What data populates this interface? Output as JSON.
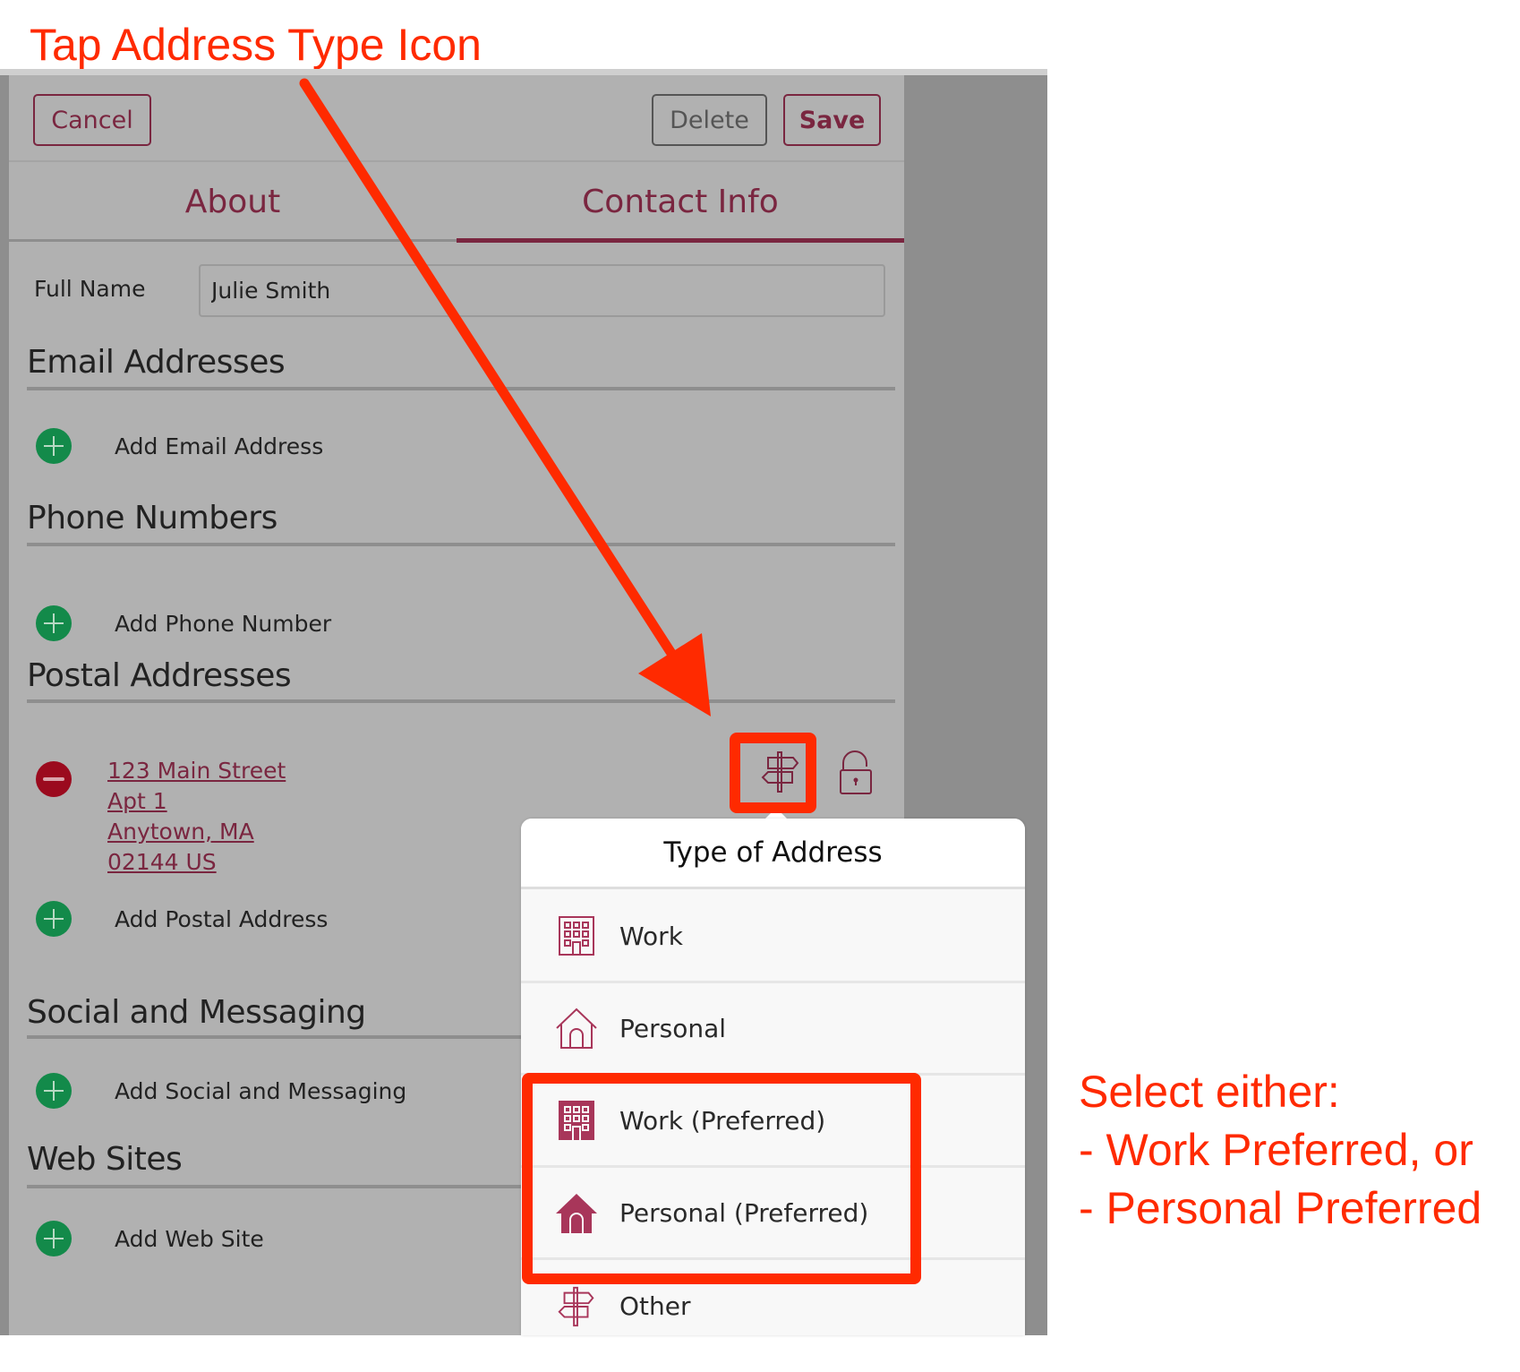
{
  "annotations": {
    "title": "Tap Address Type Icon",
    "instruction_lines": [
      "Select either:",
      "- Work Preferred, or",
      "- Personal Preferred"
    ],
    "color": "#ff2a00"
  },
  "toolbar": {
    "cancel_label": "Cancel",
    "delete_label": "Delete",
    "save_label": "Save"
  },
  "tabs": [
    {
      "label": "About",
      "active": false
    },
    {
      "label": "Contact Info",
      "active": true
    }
  ],
  "full_name": {
    "label": "Full Name",
    "value": "Julie Smith"
  },
  "sections": {
    "email": {
      "heading": "Email Addresses",
      "add_label": "Add Email Address"
    },
    "phone": {
      "heading": "Phone Numbers",
      "add_label": "Add Phone Number"
    },
    "postal": {
      "heading": "Postal Addresses",
      "address_lines": [
        "123 Main Street",
        "Apt 1",
        "Anytown, MA",
        "02144 US"
      ],
      "type_icon": "signpost-icon",
      "lock_icon": "unlocked-padlock-icon",
      "add_label": "Add Postal Address"
    },
    "social": {
      "heading": "Social and Messaging",
      "add_label": "Add Social and Messaging"
    },
    "web": {
      "heading": "Web Sites",
      "add_label": "Add Web Site"
    }
  },
  "popover": {
    "title": "Type of Address",
    "options": [
      {
        "label": "Work",
        "icon": "building-outline-icon"
      },
      {
        "label": "Personal",
        "icon": "house-outline-icon"
      },
      {
        "label": "Work (Preferred)",
        "icon": "building-filled-icon"
      },
      {
        "label": "Personal (Preferred)",
        "icon": "house-filled-icon"
      },
      {
        "label": "Other",
        "icon": "signpost-icon"
      }
    ]
  },
  "colors": {
    "accent": "#7a2640",
    "icon_maroon": "#a8365a",
    "add_green": "#138a4a",
    "remove_red": "#9b0a1e",
    "annotation_red": "#ff2a00"
  }
}
